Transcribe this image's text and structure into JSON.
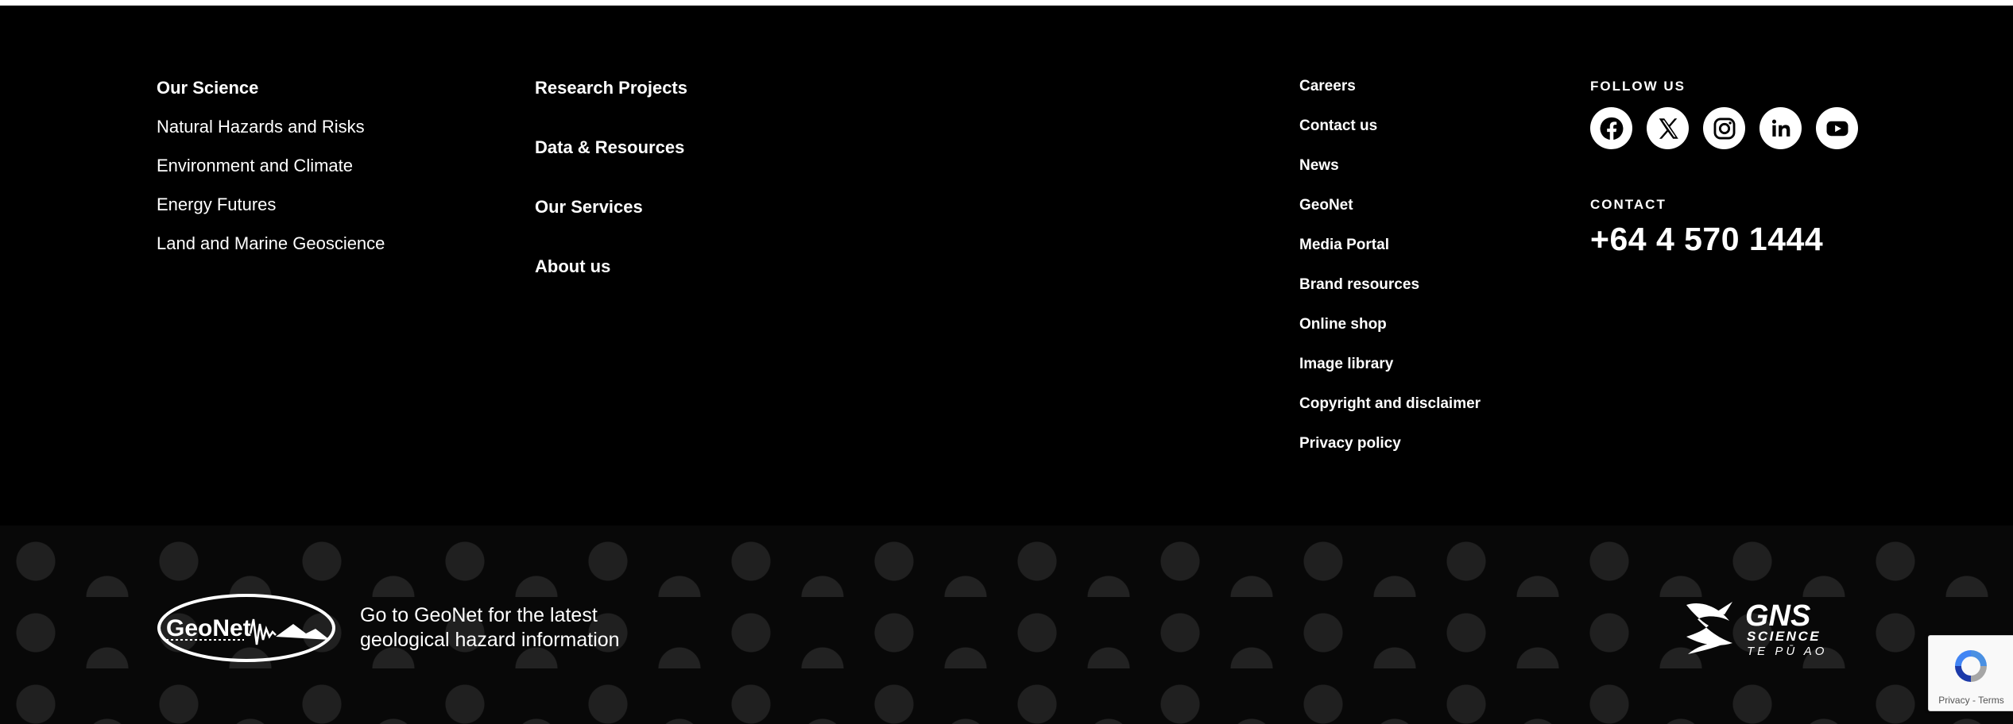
{
  "our_science": {
    "heading": "Our Science",
    "links": [
      "Natural Hazards and Risks",
      "Environment and Climate",
      "Energy Futures",
      "Land and Marine Geoscience"
    ]
  },
  "main_links": [
    "Research Projects",
    "Data & Resources",
    "Our Services",
    "About us"
  ],
  "utility_links": [
    "Careers",
    "Contact us",
    "News",
    "GeoNet",
    "Media Portal",
    "Brand resources",
    "Online shop",
    "Image library",
    "Copyright and disclaimer",
    "Privacy policy"
  ],
  "follow": {
    "label": "FOLLOW US",
    "icons": [
      "facebook-icon",
      "x-twitter-icon",
      "instagram-icon",
      "linkedin-icon",
      "youtube-icon"
    ]
  },
  "contact": {
    "label": "CONTACT",
    "phone": "+64 4 570 1444"
  },
  "geonet_promo": {
    "logo_text": "GeoNet",
    "line1": "Go to GeoNet for the latest",
    "line2": "geological hazard information"
  },
  "gns_logo": {
    "name": "GNS",
    "line1": "SCIENCE",
    "line2": "TE PŪ AO"
  },
  "recaptcha": {
    "privacy": "Privacy",
    "terms": "Terms",
    "separator": " - "
  },
  "colors": {
    "background": "#000000",
    "text": "#ffffff",
    "pattern": "#202020"
  }
}
